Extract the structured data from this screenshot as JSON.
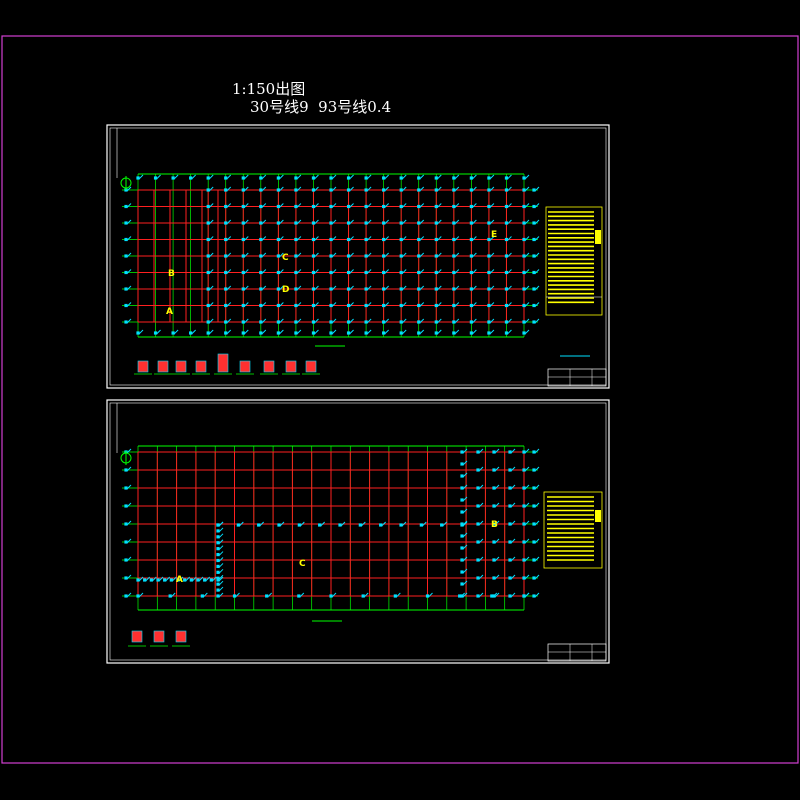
{
  "header": {
    "scale_line": "1:150出图",
    "pen_line": "30号线9  93号线0.4"
  },
  "sheet_top": {
    "zone_labels": [
      "A",
      "B",
      "C",
      "D",
      "E"
    ]
  },
  "sheet_bottom": {
    "zone_labels": [
      "A",
      "B",
      "C"
    ]
  },
  "colors": {
    "background": "#000000",
    "outer_border": "#d13fd1",
    "sheet_frame": "#ffffff",
    "axis_lines": "#00ff00",
    "beams": "#ff2020",
    "columns": "#00e0ff",
    "labels": "#ffff00",
    "detail_fill": "#ff3030"
  }
}
